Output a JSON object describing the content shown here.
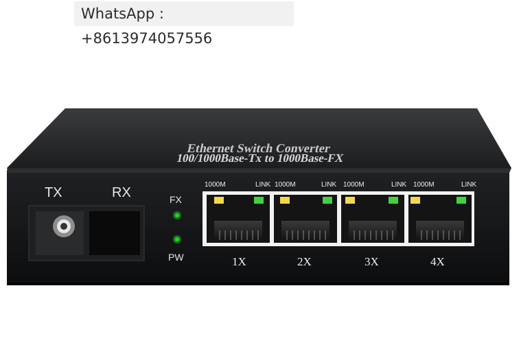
{
  "watermark": {
    "text": "WhatsApp : +8613974057556"
  },
  "device": {
    "title_line1": "Ethernet Switch Converter",
    "title_line2": "100/1000Base-Tx to 1000Base-FX",
    "fiber": {
      "tx_label": "TX",
      "rx_label": "RX"
    },
    "leds": {
      "fx_label": "FX",
      "pw_label": "PW",
      "led_color": "#2fd12f"
    },
    "ports": [
      {
        "number": "1X",
        "speed_label": "1000M",
        "link_label": "LINK"
      },
      {
        "number": "2X",
        "speed_label": "1000M",
        "link_label": "LINK"
      },
      {
        "number": "3X",
        "speed_label": "1000M",
        "link_label": "LINK"
      },
      {
        "number": "4X",
        "speed_label": "1000M",
        "link_label": "LINK"
      }
    ],
    "colors": {
      "body": "#1b1c1e",
      "front": "#111214",
      "port_frame": "#f2f2f2",
      "speed_led": "#f5d84a",
      "link_led": "#3ed43e"
    }
  }
}
